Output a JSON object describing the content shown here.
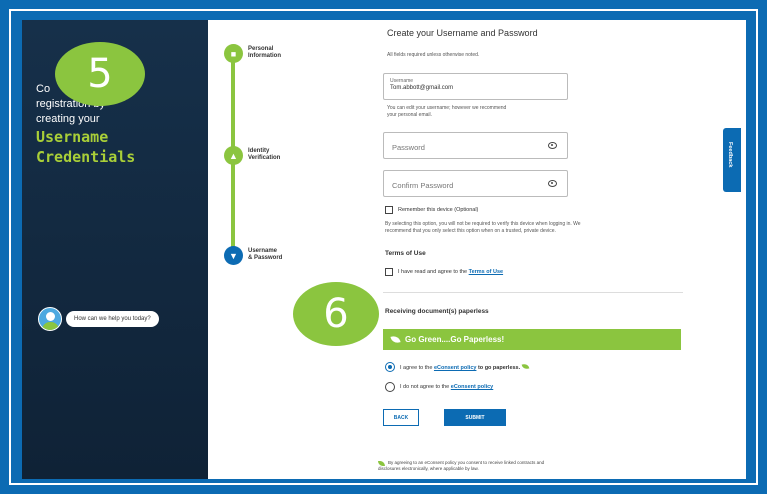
{
  "left_panel": {
    "line1": "Co",
    "line2": "registration by",
    "line3": "creating your",
    "highlight1": "Username",
    "highlight2": "Credentials",
    "chat_prompt": "How can we help you today?"
  },
  "steps": [
    {
      "label_line1": "Personal",
      "label_line2": "Information"
    },
    {
      "label_line1": "Identity",
      "label_line2": "Verification"
    },
    {
      "label_line1": "Username",
      "label_line2": "& Password"
    }
  ],
  "form": {
    "title": "Create your Username and Password",
    "required_note": "All fields required unless otherwise noted.",
    "username_label": "Username",
    "username_value": "Tom.abbott@gmail.com",
    "username_help_1": "You can edit your username; however we recommend",
    "username_help_2": "your personal email.",
    "password_placeholder": "Password",
    "confirm_password_placeholder": "Confirm Password",
    "remember_label": "Remember this device (Optional)",
    "remember_help_1": "By selecting this option, you will not be required to verify this device when logging in. We",
    "remember_help_2": "recommend that you only select this option when on a trusted, private device.",
    "terms_heading": "Terms of Use",
    "terms_label_pre": "I have read and agree to the",
    "terms_link": "Terms of Use",
    "paperless_heading": "Receiving document(s) paperless",
    "banner_text": "Go Green....Go Paperless!",
    "agree_pre": "I agree to the",
    "agree_link": "eConsent policy",
    "agree_post": "to go paperless.",
    "disagree_pre": "I do not agree to the",
    "disagree_link": "eConsent policy",
    "back_label": "BACK",
    "submit_label": "SUBMIT",
    "footer_1": "By agreeing to an eConsent policy you consent to receive linked contracts and",
    "footer_2": "disclosures electronically, where applicable by law."
  },
  "feedback_label": "Feedback",
  "callouts": {
    "first": "5",
    "second": "6"
  },
  "colors": {
    "accent_blue": "#0c6bb3",
    "accent_green": "#8bc53f",
    "panel_dark": "#16304a"
  }
}
